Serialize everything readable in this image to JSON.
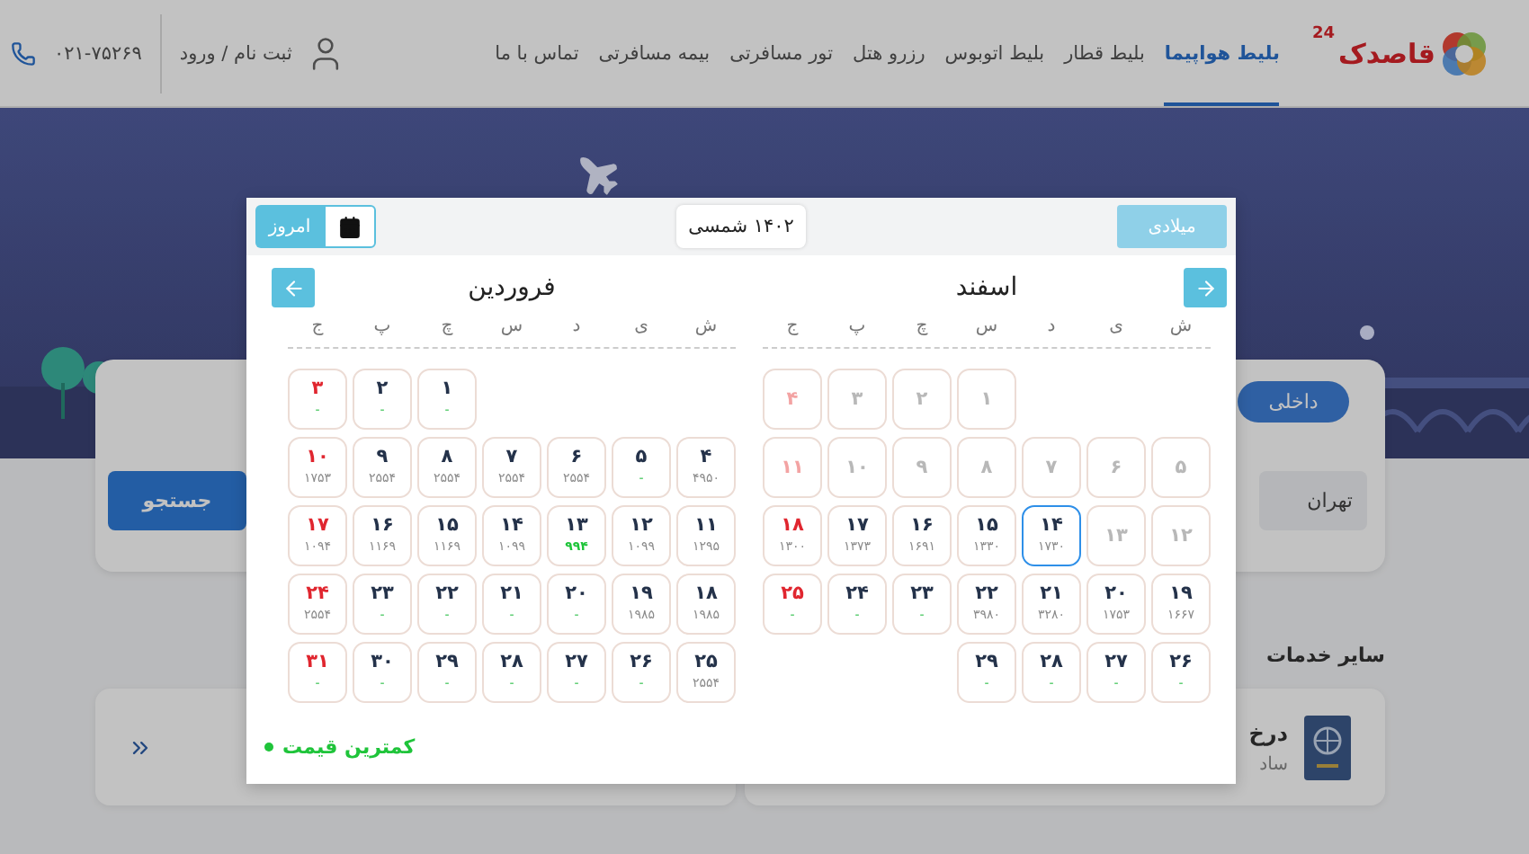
{
  "header": {
    "logo": {
      "name": "قاصدک",
      "badge": "24"
    },
    "nav": [
      {
        "label": "بلیط هواپیما",
        "selected": true
      },
      {
        "label": "بلیط قطار",
        "selected": false
      },
      {
        "label": "بلیط اتوبوس",
        "selected": false
      },
      {
        "label": "رزرو هتل",
        "selected": false
      },
      {
        "label": "تور مسافرتی",
        "selected": false
      },
      {
        "label": "بیمه مسافرتی",
        "selected": false
      },
      {
        "label": "تماس با ما",
        "selected": false
      }
    ],
    "account": "ثبت نام / ورود",
    "phone": "۰۲۱-۷۵۲۶۹"
  },
  "search": {
    "tab": {
      "label": "داخلی",
      "selected": true
    },
    "origin": "تهران",
    "button": "جستجو"
  },
  "services": {
    "title": "سایر خدمات",
    "cards": [
      {
        "title": "درخ",
        "subtitle": "ساد"
      }
    ]
  },
  "calendar": {
    "toggle": "میلادی",
    "year": "۱۴۰۲ شمسی",
    "today": "امروز",
    "legend": "کمترین قیمت",
    "months": [
      {
        "title": "اسفند",
        "kind": "next",
        "weekdays": [
          "ش",
          "ی",
          "د",
          "س",
          "چ",
          "پ",
          "ج"
        ],
        "days": [
          {
            "kind": "empty"
          },
          {
            "kind": "empty"
          },
          {
            "kind": "empty"
          },
          {
            "kind": "past",
            "day": "۱",
            "holiday": false,
            "selected": false
          },
          {
            "kind": "past",
            "day": "۲",
            "holiday": false,
            "selected": false
          },
          {
            "kind": "past",
            "day": "۳",
            "holiday": false,
            "selected": false
          },
          {
            "kind": "past",
            "day": "۴",
            "holiday": true,
            "selected": false
          },
          {
            "kind": "past",
            "day": "۵",
            "holiday": false,
            "selected": false
          },
          {
            "kind": "past",
            "day": "۶",
            "holiday": false,
            "selected": false
          },
          {
            "kind": "past",
            "day": "۷",
            "holiday": false,
            "selected": false
          },
          {
            "kind": "past",
            "day": "۸",
            "holiday": false,
            "selected": false
          },
          {
            "kind": "past",
            "day": "۹",
            "holiday": false,
            "selected": false
          },
          {
            "kind": "past",
            "day": "۱۰",
            "holiday": false,
            "selected": false
          },
          {
            "kind": "past",
            "day": "۱۱",
            "holiday": true,
            "selected": false
          },
          {
            "kind": "past",
            "day": "۱۲",
            "holiday": false,
            "selected": false
          },
          {
            "kind": "past",
            "day": "۱۳",
            "holiday": false,
            "selected": false
          },
          {
            "kind": "priced",
            "day": "۱۴",
            "price": "۱۷۳۰",
            "holiday": false,
            "selected": true
          },
          {
            "kind": "priced",
            "day": "۱۵",
            "price": "۱۳۳۰",
            "holiday": false,
            "selected": false
          },
          {
            "kind": "priced",
            "day": "۱۶",
            "price": "۱۶۹۱",
            "holiday": false,
            "selected": false
          },
          {
            "kind": "priced",
            "day": "۱۷",
            "price": "۱۳۷۳",
            "holiday": false,
            "selected": false
          },
          {
            "kind": "priced",
            "day": "۱۸",
            "price": "۱۳۰۰",
            "holiday": true,
            "selected": false
          },
          {
            "kind": "priced",
            "day": "۱۹",
            "price": "۱۶۶۷",
            "holiday": false,
            "selected": false
          },
          {
            "kind": "priced",
            "day": "۲۰",
            "price": "۱۷۵۳",
            "holiday": false,
            "selected": false
          },
          {
            "kind": "priced",
            "day": "۲۱",
            "price": "۳۲۸۰",
            "holiday": false,
            "selected": false
          },
          {
            "kind": "priced",
            "day": "۲۲",
            "price": "۳۹۸۰",
            "holiday": false,
            "selected": false
          },
          {
            "kind": "no-flight",
            "day": "۲۳",
            "price": "-",
            "holiday": false,
            "selected": false
          },
          {
            "kind": "no-flight",
            "day": "۲۴",
            "price": "-",
            "holiday": false,
            "selected": false
          },
          {
            "kind": "no-flight",
            "day": "۲۵",
            "price": "-",
            "holiday": true,
            "selected": false
          },
          {
            "kind": "no-flight",
            "day": "۲۶",
            "price": "-",
            "holiday": false,
            "selected": false
          },
          {
            "kind": "no-flight",
            "day": "۲۷",
            "price": "-",
            "holiday": false,
            "selected": false
          },
          {
            "kind": "no-flight",
            "day": "۲۸",
            "price": "-",
            "holiday": false,
            "selected": false
          },
          {
            "kind": "no-flight",
            "day": "۲۹",
            "price": "-",
            "holiday": false,
            "selected": false
          }
        ]
      },
      {
        "title": "فروردین",
        "kind": "prev",
        "weekdays": [
          "ش",
          "ی",
          "د",
          "س",
          "چ",
          "پ",
          "ج"
        ],
        "days": [
          {
            "kind": "empty"
          },
          {
            "kind": "empty"
          },
          {
            "kind": "empty"
          },
          {
            "kind": "empty"
          },
          {
            "kind": "no-flight",
            "day": "۱",
            "price": "-",
            "holiday": false,
            "selected": false
          },
          {
            "kind": "no-flight",
            "day": "۲",
            "price": "-",
            "holiday": false,
            "selected": false
          },
          {
            "kind": "no-flight",
            "day": "۳",
            "price": "-",
            "holiday": true,
            "selected": false
          },
          {
            "kind": "priced",
            "day": "۴",
            "price": "۴۹۵۰",
            "holiday": false,
            "selected": false
          },
          {
            "kind": "no-flight",
            "day": "۵",
            "price": "-",
            "holiday": false,
            "selected": false
          },
          {
            "kind": "priced",
            "day": "۶",
            "price": "۲۵۵۴",
            "holiday": false,
            "selected": false
          },
          {
            "kind": "priced",
            "day": "۷",
            "price": "۲۵۵۴",
            "holiday": false,
            "selected": false
          },
          {
            "kind": "priced",
            "day": "۸",
            "price": "۲۵۵۴",
            "holiday": false,
            "selected": false
          },
          {
            "kind": "priced",
            "day": "۹",
            "price": "۲۵۵۴",
            "holiday": false,
            "selected": false
          },
          {
            "kind": "priced",
            "day": "۱۰",
            "price": "۱۷۵۳",
            "holiday": true,
            "selected": false
          },
          {
            "kind": "priced",
            "day": "۱۱",
            "price": "۱۲۹۵",
            "holiday": false,
            "selected": false
          },
          {
            "kind": "priced",
            "day": "۱۲",
            "price": "۱۰۹۹",
            "holiday": false,
            "selected": false
          },
          {
            "kind": "cheapest",
            "day": "۱۳",
            "price": "۹۹۴",
            "holiday": false,
            "selected": false
          },
          {
            "kind": "priced",
            "day": "۱۴",
            "price": "۱۰۹۹",
            "holiday": false,
            "selected": false
          },
          {
            "kind": "priced",
            "day": "۱۵",
            "price": "۱۱۶۹",
            "holiday": false,
            "selected": false
          },
          {
            "kind": "priced",
            "day": "۱۶",
            "price": "۱۱۶۹",
            "holiday": false,
            "selected": false
          },
          {
            "kind": "priced",
            "day": "۱۷",
            "price": "۱۰۹۴",
            "holiday": true,
            "selected": false
          },
          {
            "kind": "priced",
            "day": "۱۸",
            "price": "۱۹۸۵",
            "holiday": false,
            "selected": false
          },
          {
            "kind": "priced",
            "day": "۱۹",
            "price": "۱۹۸۵",
            "holiday": false,
            "selected": false
          },
          {
            "kind": "no-flight",
            "day": "۲۰",
            "price": "-",
            "holiday": false,
            "selected": false
          },
          {
            "kind": "no-flight",
            "day": "۲۱",
            "price": "-",
            "holiday": false,
            "selected": false
          },
          {
            "kind": "no-flight",
            "day": "۲۲",
            "price": "-",
            "holiday": false,
            "selected": false
          },
          {
            "kind": "no-flight",
            "day": "۲۳",
            "price": "-",
            "holiday": false,
            "selected": false
          },
          {
            "kind": "priced",
            "day": "۲۴",
            "price": "۲۵۵۴",
            "holiday": true,
            "selected": false
          },
          {
            "kind": "priced",
            "day": "۲۵",
            "price": "۲۵۵۴",
            "holiday": false,
            "selected": false
          },
          {
            "kind": "no-flight",
            "day": "۲۶",
            "price": "-",
            "holiday": false,
            "selected": false
          },
          {
            "kind": "no-flight",
            "day": "۲۷",
            "price": "-",
            "holiday": false,
            "selected": false
          },
          {
            "kind": "no-flight",
            "day": "۲۸",
            "price": "-",
            "holiday": false,
            "selected": false
          },
          {
            "kind": "no-flight",
            "day": "۲۹",
            "price": "-",
            "holiday": false,
            "selected": false
          },
          {
            "kind": "no-flight",
            "day": "۳۰",
            "price": "-",
            "holiday": false,
            "selected": false
          },
          {
            "kind": "no-flight",
            "day": "۳۱",
            "price": "-",
            "holiday": true,
            "selected": false
          }
        ]
      }
    ]
  }
}
